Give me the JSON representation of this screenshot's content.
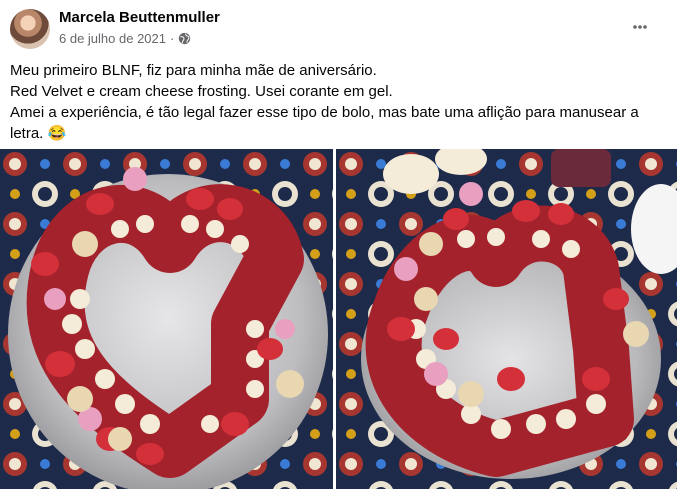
{
  "post": {
    "author": "Marcela Beuttenmuller",
    "date": "6 de julho de 2021",
    "separator": "·",
    "privacy_icon": "globe-icon",
    "menu_icon": "more-options-icon",
    "lines": [
      "Meu primeiro BLNF, fiz para minha mãe de aniversário.",
      "Red Velvet e cream cheese frosting. Usei corante em gel.",
      "Amei a experiência, é tão legal fazer esse tipo de bolo, mas bate uma aflição para manusear a letra. 😂"
    ]
  },
  "photos": [
    {
      "subject": "heart-shaped red velvet number cake on silver board, top view"
    },
    {
      "subject": "heart-shaped red velvet number cake on silver board, angled view"
    }
  ],
  "colors": {
    "text": "#050505",
    "meta": "#65676b",
    "cake_red": "#a4222c",
    "frosting": "#f4ecd8",
    "strawberry": "#d4303a",
    "board": "#c9c9cb",
    "tablecloth": "#1d2a4a"
  }
}
